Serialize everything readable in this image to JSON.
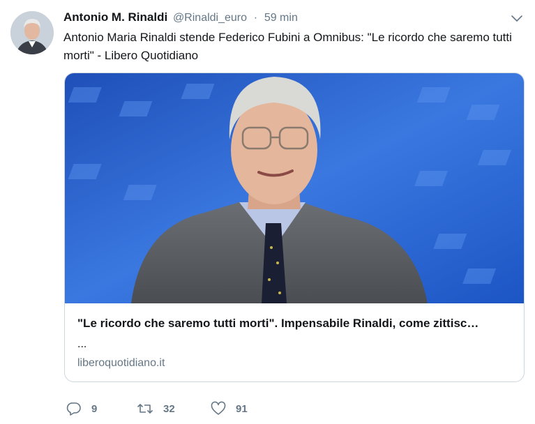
{
  "tweet": {
    "author_name": "Antonio M. Rinaldi",
    "handle": "@Rinaldi_euro",
    "separator": "·",
    "time": "59 min",
    "text": "Antonio Maria Rinaldi stende Federico Fubini a Omnibus: \"Le ricordo che saremo tutti morti\" - Libero Quotidiano"
  },
  "card": {
    "title": "\"Le ricordo che saremo tutti morti\". Impensabile Rinaldi, come zittisc…",
    "description": "...",
    "domain": "liberoquotidiano.it"
  },
  "actions": {
    "replies": "9",
    "retweets": "32",
    "likes": "91"
  },
  "icons": {
    "reply": "reply-icon",
    "retweet": "retweet-icon",
    "like": "heart-icon",
    "menu": "chevron-down-icon"
  },
  "colors": {
    "text": "#14171a",
    "secondary": "#657786",
    "border": "#ccd6dd"
  }
}
